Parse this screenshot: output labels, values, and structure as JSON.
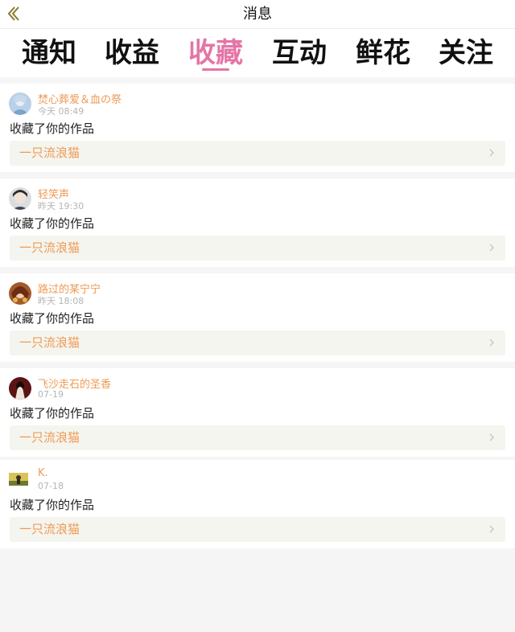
{
  "header": {
    "title": "消息"
  },
  "tabs": [
    {
      "label": "通知"
    },
    {
      "label": "收益"
    },
    {
      "label": "收藏"
    },
    {
      "label": "互动"
    },
    {
      "label": "鲜花"
    },
    {
      "label": "关注"
    }
  ],
  "active_tab": "收藏",
  "colors": {
    "accent_pink": "#e575a6",
    "username_orange": "#ee9a55",
    "work_bg": "#f5f5ef"
  },
  "notifications": [
    {
      "username": "焚心葬爱＆血の祭",
      "time": "今天 08:49",
      "action": "收藏了你的作品",
      "work_title": "一只流浪猫"
    },
    {
      "username": "轻笑声",
      "time": "昨天 19:30",
      "action": "收藏了你的作品",
      "work_title": "一只流浪猫"
    },
    {
      "username": "路过的某宁宁",
      "time": "昨天 18:08",
      "action": "收藏了你的作品",
      "work_title": "一只流浪猫"
    },
    {
      "username": "飞沙走石的圣香",
      "time": "07-19",
      "action": "收藏了你的作品",
      "work_title": "一只流浪猫"
    },
    {
      "username": "K.",
      "time": "07-18",
      "action": "收藏了你的作品",
      "work_title": "一只流浪猫"
    }
  ]
}
